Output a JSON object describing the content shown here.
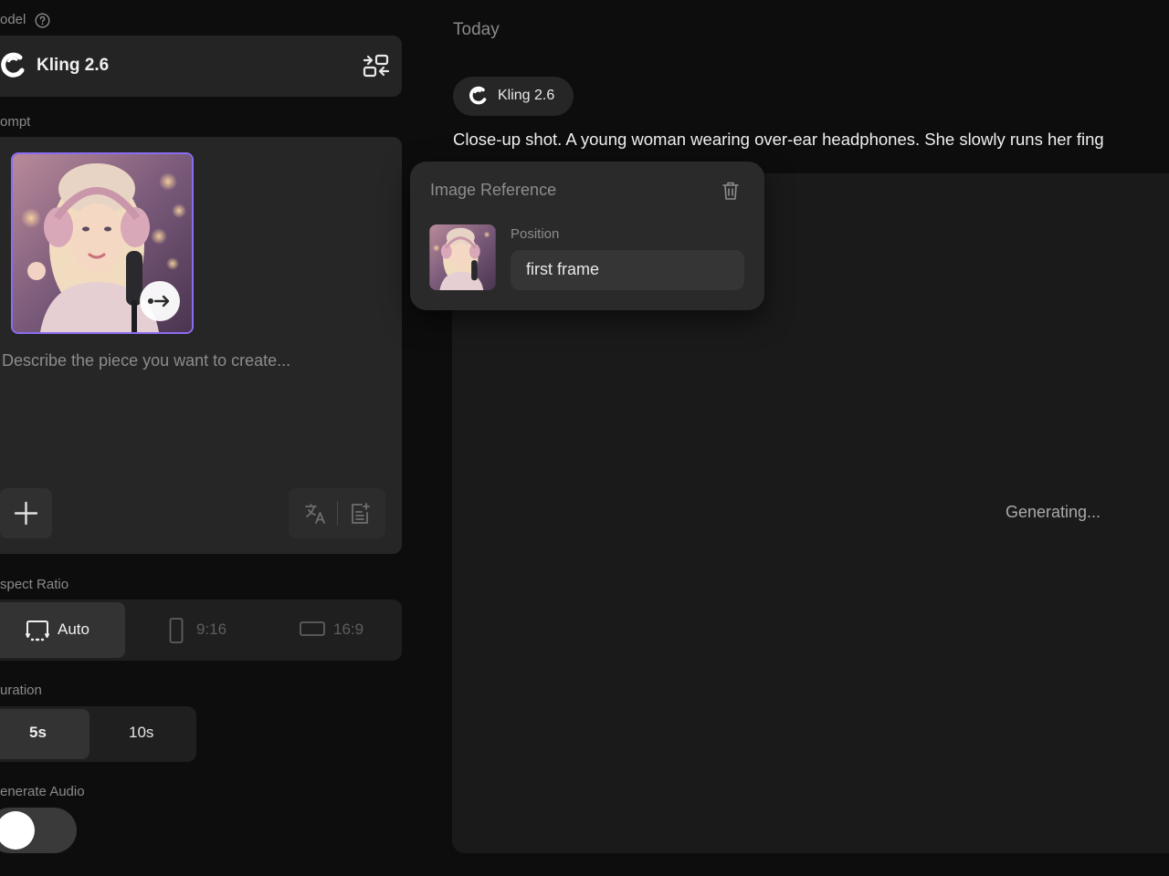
{
  "sidebar": {
    "model_label": "odel",
    "model_name": "Kling 2.6",
    "prompt_label": "ompt",
    "prompt_placeholder": "Describe the piece you want to create...",
    "aspect_label": "spect Ratio",
    "aspect_options": [
      {
        "label": "Auto",
        "selected": true
      },
      {
        "label": "9:16",
        "selected": false
      },
      {
        "label": "16:9",
        "selected": false
      }
    ],
    "duration_label": "uration",
    "duration_options": [
      {
        "label": "5s",
        "selected": true
      },
      {
        "label": "10s",
        "selected": false
      }
    ],
    "audio_label": "enerate Audio",
    "audio_on": false
  },
  "main": {
    "section_title": "Today",
    "model_chip": "Kling 2.6",
    "prompt_text": "Close-up shot. A young woman wearing over-ear headphones. She slowly runs her fing",
    "status": "Generating..."
  },
  "image_reference": {
    "title": "Image Reference",
    "position_label": "Position",
    "position_value": "first frame"
  },
  "colors": {
    "accent_border": "#8a6cf0",
    "panel": "#242424",
    "background": "#0d0d0d"
  }
}
